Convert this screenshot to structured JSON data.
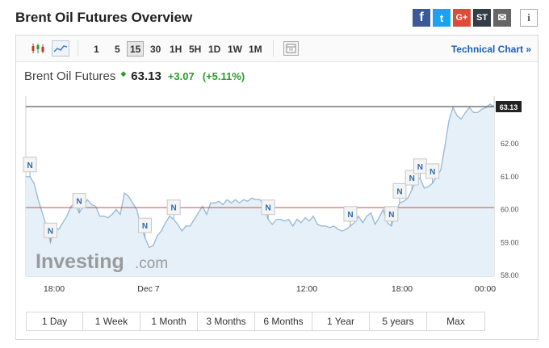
{
  "page_title": "Brent Oil Futures Overview",
  "share": {
    "facebook": "f",
    "twitter": "t",
    "googleplus": "G+",
    "stocktwits": "ST",
    "email": "✉",
    "info": "i"
  },
  "toolbar": {
    "timeframes": [
      "1",
      "5",
      "15",
      "30",
      "1H",
      "5H",
      "1D",
      "1W",
      "1M"
    ],
    "active_timeframe": "15",
    "technical_link": "Technical Chart »"
  },
  "quote": {
    "name": "Brent Oil Futures",
    "price": "63.13",
    "change": "+3.07",
    "change_pct": "(+5.11%)",
    "colors": {
      "up": "#2a9d2a"
    }
  },
  "watermark": {
    "brand": "Investing",
    "suffix": ".com"
  },
  "chart_data": {
    "type": "area",
    "y_ticks": [
      "63.13",
      "62.00",
      "61.00",
      "60.00",
      "59.00",
      "58.00"
    ],
    "x_ticks": [
      "18:00",
      "Dec 7",
      "12:00",
      "18:00",
      "00:00"
    ],
    "ylim": [
      58.0,
      63.13
    ],
    "last_price": 63.13,
    "previous_close": 60.06,
    "news_marker_label": "N",
    "colors": {
      "line": "#9bbcd6",
      "fill": "#e6f0f8",
      "prev_close": "#c0504d",
      "last_line": "#333333"
    },
    "series": [
      {
        "values": [
          61.0,
          61.0,
          60.8,
          60.3,
          59.9,
          59.5,
          59.0,
          59.45,
          59.4,
          59.6,
          59.8,
          60.1,
          60.2,
          59.9,
          60.1,
          60.3,
          60.15,
          60.1,
          59.8,
          59.8,
          59.75,
          59.85,
          60.0,
          59.85,
          60.5,
          60.4,
          60.2,
          60.0,
          59.5,
          59.15,
          58.85,
          58.9,
          59.2,
          59.35,
          59.6,
          59.8,
          59.7,
          59.55,
          59.35,
          59.5,
          59.5,
          59.7,
          59.9,
          60.1,
          59.85,
          60.2,
          60.2,
          60.25,
          60.15,
          60.3,
          60.2,
          60.3,
          60.2,
          60.3,
          60.25,
          60.35,
          60.3,
          60.3,
          60.1,
          59.7,
          59.55,
          59.7,
          59.7,
          59.65,
          59.7,
          59.5,
          59.7,
          59.6,
          59.75,
          59.65,
          59.8,
          59.55,
          59.5,
          59.5,
          59.45,
          59.5,
          59.4,
          59.35,
          59.4,
          59.5,
          59.6,
          59.8,
          59.6,
          59.8,
          59.9,
          59.55,
          59.75,
          60.0,
          59.6,
          59.5,
          59.9,
          60.2,
          60.25,
          60.35,
          60.6,
          60.9,
          60.95,
          60.65,
          60.7,
          60.8,
          61.0,
          61.2,
          61.9,
          62.7,
          63.1,
          62.85,
          62.75,
          62.95,
          63.1,
          62.95,
          62.95,
          63.05,
          63.1,
          63.2,
          63.13
        ]
      }
    ],
    "news_markers": [
      {
        "index": 1,
        "value": 61.0
      },
      {
        "index": 6,
        "value": 59.0
      },
      {
        "index": 13,
        "value": 59.9
      },
      {
        "index": 29,
        "value": 59.15
      },
      {
        "index": 36,
        "value": 59.7
      },
      {
        "index": 59,
        "value": 59.7
      },
      {
        "index": 79,
        "value": 59.5
      },
      {
        "index": 89,
        "value": 59.5
      },
      {
        "index": 91,
        "value": 60.2
      },
      {
        "index": 94,
        "value": 60.6
      },
      {
        "index": 96,
        "value": 60.95
      },
      {
        "index": 99,
        "value": 60.8
      }
    ]
  },
  "range_buttons": [
    "1 Day",
    "1 Week",
    "1 Month",
    "3 Months",
    "6 Months",
    "1 Year",
    "5 years",
    "Max"
  ]
}
